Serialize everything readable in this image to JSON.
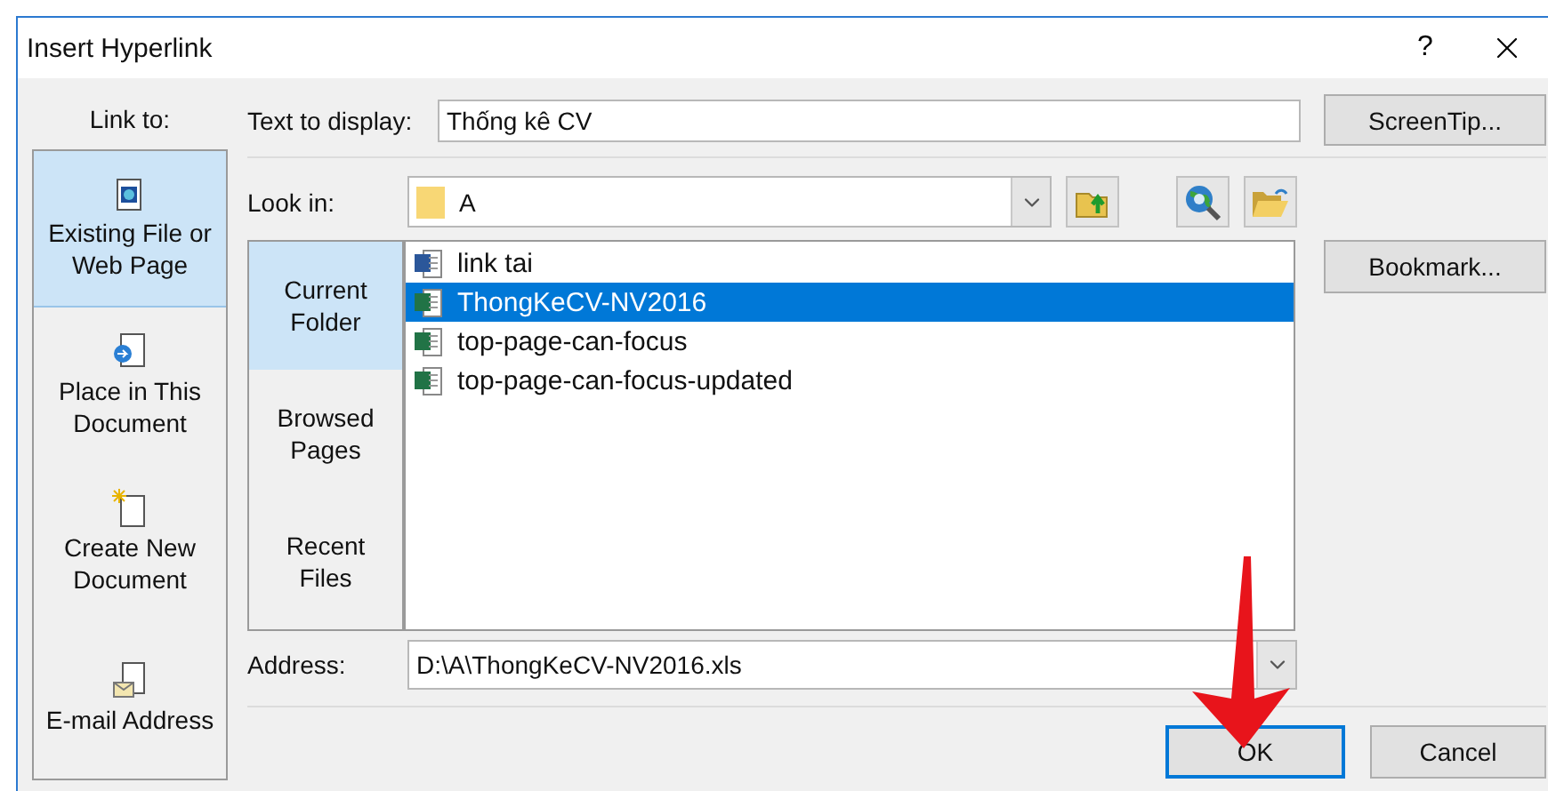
{
  "window": {
    "title": "Insert Hyperlink",
    "help": "?"
  },
  "link_to": {
    "label": "Link to:",
    "items": [
      {
        "label": "Existing File or Web Page",
        "kind": "file",
        "selected": true
      },
      {
        "label": "Place in This Document",
        "kind": "place",
        "selected": false
      },
      {
        "label": "Create New Document",
        "kind": "new",
        "selected": false
      },
      {
        "label": "E-mail Address",
        "kind": "email",
        "selected": false
      }
    ]
  },
  "text_to_display": {
    "label": "Text to display:",
    "value": "Thống kê CV"
  },
  "screentip_button": "ScreenTip...",
  "look_in": {
    "label": "Look in:",
    "value": "A"
  },
  "nav": [
    {
      "label": "Current Folder",
      "selected": true
    },
    {
      "label": "Browsed Pages",
      "selected": false
    },
    {
      "label": "Recent Files",
      "selected": false
    }
  ],
  "files": [
    {
      "name": "link tai",
      "kind": "word",
      "selected": false
    },
    {
      "name": "ThongKeCV-NV2016",
      "kind": "excel",
      "selected": true
    },
    {
      "name": "top-page-can-focus",
      "kind": "excel",
      "selected": false
    },
    {
      "name": "top-page-can-focus-updated",
      "kind": "excel",
      "selected": false
    }
  ],
  "bookmark_button": "Bookmark...",
  "address": {
    "label": "Address:",
    "value": "D:\\A\\ThongKeCV-NV2016.xls"
  },
  "buttons": [
    {
      "label": "OK",
      "default": true
    },
    {
      "label": "Cancel",
      "default": false
    }
  ]
}
